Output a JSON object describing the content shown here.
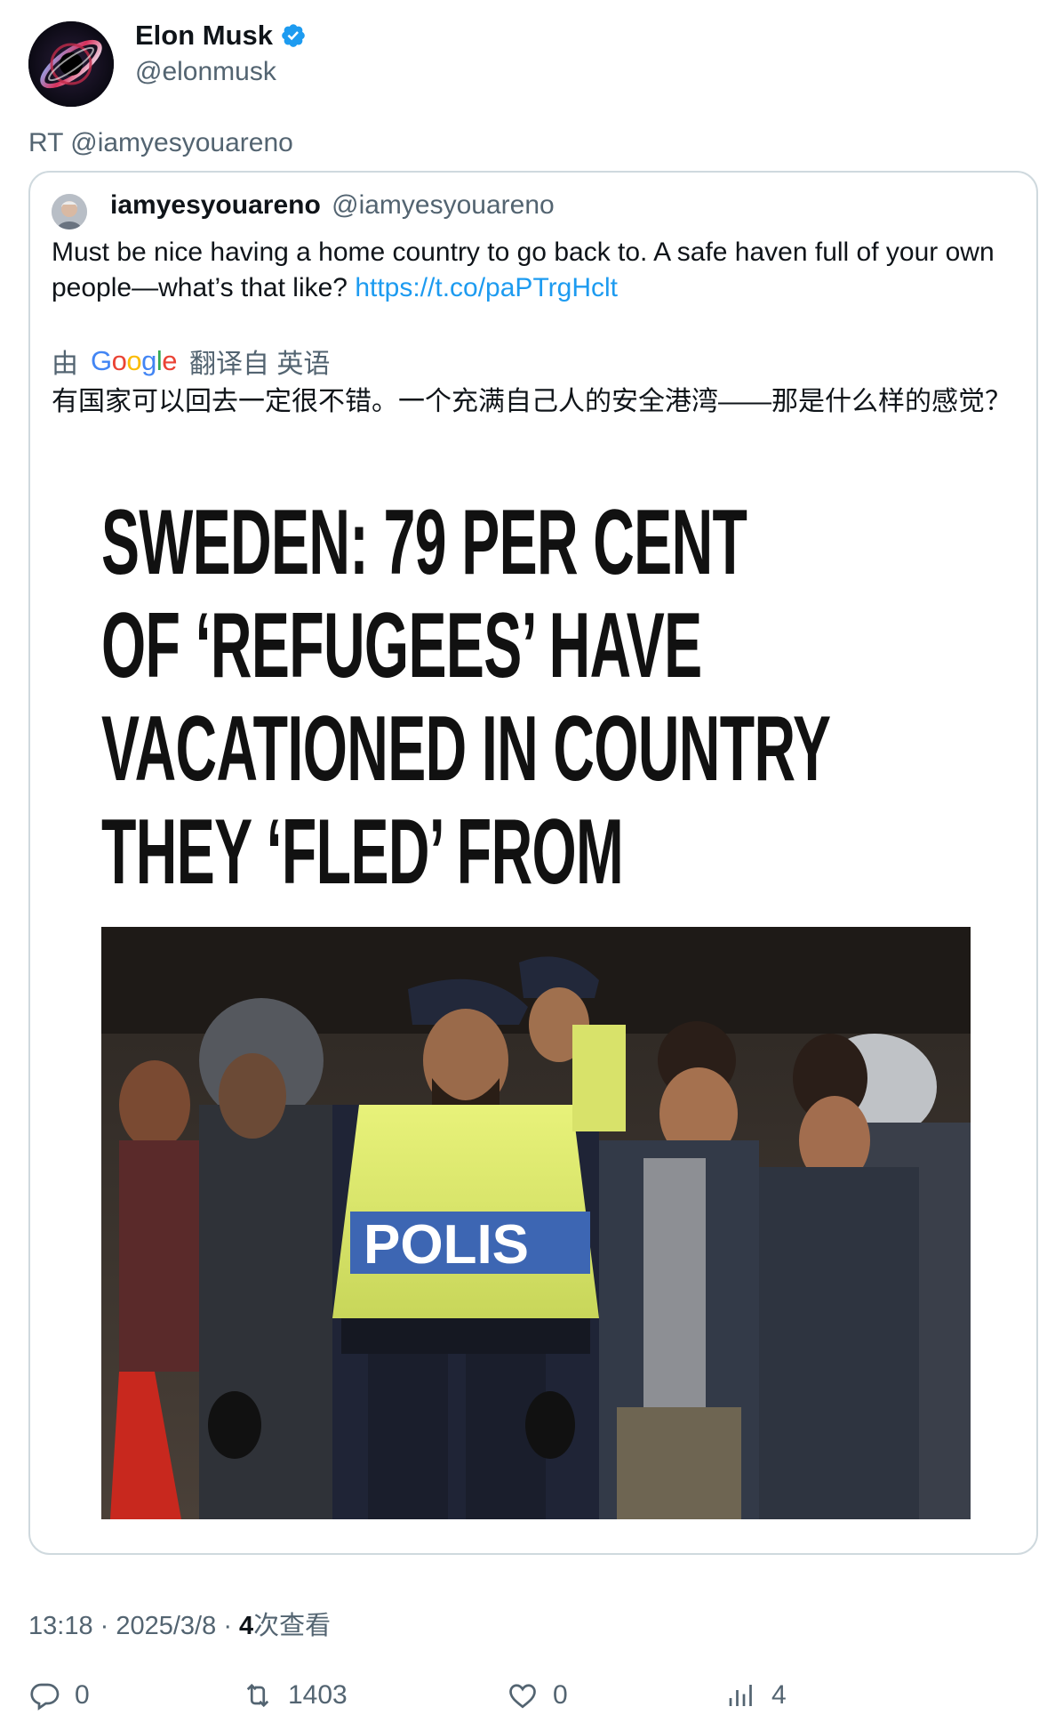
{
  "author": {
    "name": "Elon Musk",
    "handle": "@elonmusk",
    "verified": true
  },
  "retweet_line": "RT @iamyesyouareno",
  "quoted": {
    "name": "iamyesyouareno",
    "handle": "@iamyesyouareno",
    "text": "Must be nice having a home country to go back to. A safe haven full of your own people—what’s that like? ",
    "link": "https://t.co/paPTrgHclt",
    "translate_prefix": "由",
    "translate_brand": "Google",
    "translate_suffix": "翻译自 英语",
    "translated_text": "有国家可以回去一定很不错。一个充满自己人的安全港湾——那是什么样的感觉？",
    "headline": [
      "SWEDEN: 79 PER CENT",
      "OF ‘REFUGEES’ HAVE",
      "VACATIONED IN COUNTRY",
      "THEY ‘FLED’ FROM"
    ],
    "photo_text": "POLIS"
  },
  "meta": {
    "time": "13:18",
    "date": "2025/3/8",
    "views_count": "4",
    "views_label": "次查看"
  },
  "actions": {
    "replies": "0",
    "retweets": "1403",
    "likes": "0",
    "views": "4"
  },
  "colors": {
    "link": "#1d9bf0",
    "secondary_text": "#536471",
    "border": "#cfd9de",
    "verified": "#1d9bf0"
  }
}
